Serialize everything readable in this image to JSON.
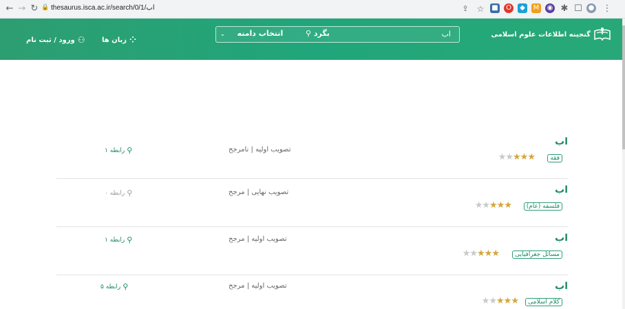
{
  "browser": {
    "url": "thesaurus.isca.ac.ir/search/0/1/اب"
  },
  "header": {
    "logo_text": "گنجینه اطلاعات علوم اسلامی",
    "search_value": "اب",
    "search_button": "بگرد",
    "domain_select": "انتخاب دامنه",
    "languages": "زبان ها",
    "login": "ورود / ثبت نام"
  },
  "results": [
    {
      "term": "اب",
      "domain": "فقه",
      "stars": 2,
      "status": "تصویب اولیه | نامرجح",
      "relations": "۱ رابطه",
      "rel_muted": false
    },
    {
      "term": "اب",
      "domain": "فلسفه (عام)",
      "stars": 2,
      "status": "تصویب نهایی | مرجح",
      "relations": "۰ رابطه",
      "rel_muted": true
    },
    {
      "term": "اب",
      "domain": "مسائل جغرافیایی",
      "stars": 2,
      "status": "تصویب اولیه | مرجح",
      "relations": "۱ رابطه",
      "rel_muted": false
    },
    {
      "term": "اب",
      "domain": "کلام اسلامی",
      "stars": 2,
      "status": "تصویب اولیه | مرجح",
      "relations": "۵ رابطه",
      "rel_muted": false
    }
  ],
  "colors": {
    "brand": "#20a67a",
    "star": "#d4a63a"
  }
}
